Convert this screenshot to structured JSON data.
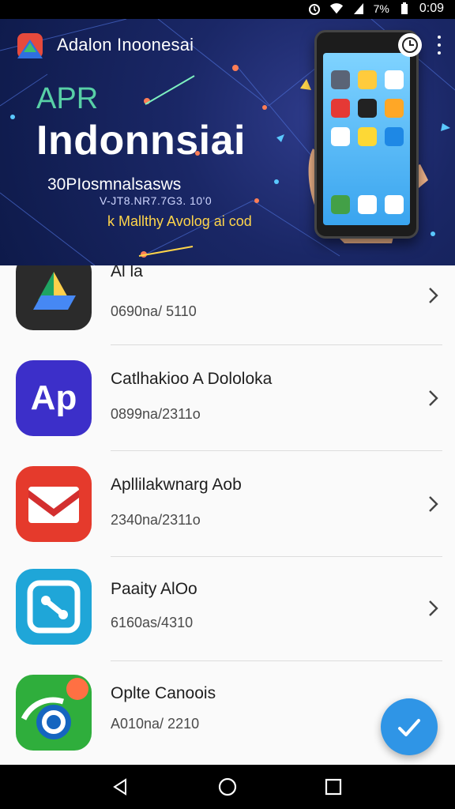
{
  "status_bar": {
    "battery_text": "7%",
    "time": "0:09",
    "icons": [
      "alarm-icon",
      "wifi-icon",
      "signal-icon",
      "battery-icon"
    ]
  },
  "banner": {
    "app_title": "Adalon Inoonesai",
    "hero_small": "APR",
    "hero_big": "Indonnsiai",
    "line1": "30PIosmnalsasws",
    "line2": "V-JT8.NR7.7G3. 10'0",
    "line3": "k Mallthy Avolog ai cod",
    "icons": [
      "app-logo-icon",
      "clock-icon",
      "more-vert-icon"
    ]
  },
  "apps": [
    {
      "name": "Al la",
      "sub": "0690na/ 5110",
      "icon": "google-drive-icon"
    },
    {
      "name": "Catlhakioo A Dololoka",
      "sub": "0899na/2311o",
      "icon": "ap-letters-icon"
    },
    {
      "name": "Apllilakwnarg Aob",
      "sub": "2340na/2311o",
      "icon": "gmail-icon"
    },
    {
      "name": "Paaity AlOo",
      "sub": "6160as/4310",
      "icon": "remote-tools-icon"
    },
    {
      "name": "Oplte Canoois",
      "sub": "A010na/ 2210",
      "icon": "location-badge-icon"
    }
  ],
  "fab": {
    "icon": "check-icon"
  },
  "navbar": {
    "icons": [
      "back-icon",
      "home-icon",
      "recents-icon"
    ]
  },
  "colors": {
    "banner_bg": "#1a2766",
    "fab": "#2f95e6",
    "accent_green": "#58d0a6",
    "accent_yellow": "#ffd54a"
  }
}
